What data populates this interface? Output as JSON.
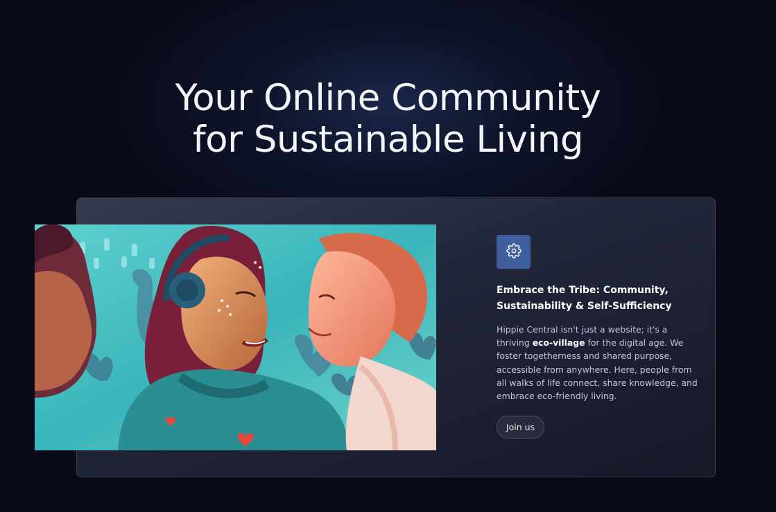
{
  "hero": {
    "title_line1": "Your Online Community",
    "title_line2": "for Sustainable Living"
  },
  "feature": {
    "icon": "gear-icon",
    "title_line1": "Embrace the Tribe: Community,",
    "title_line2": "Sustainability & Self-Sufficiency",
    "text_part1": "Hippie Central isn't just a website; it's a thriving ",
    "text_bold": "eco-village",
    "text_part2": " for the digital age. We foster togetherness and shared purpose, accessible from anywhere. Here, people from all walks of life connect, share knowledge, and embrace eco-friendly living.",
    "button_label": "Join us"
  },
  "colors": {
    "background": "#090b19",
    "icon_box": "#3f5f9e",
    "card": "#22263a"
  }
}
